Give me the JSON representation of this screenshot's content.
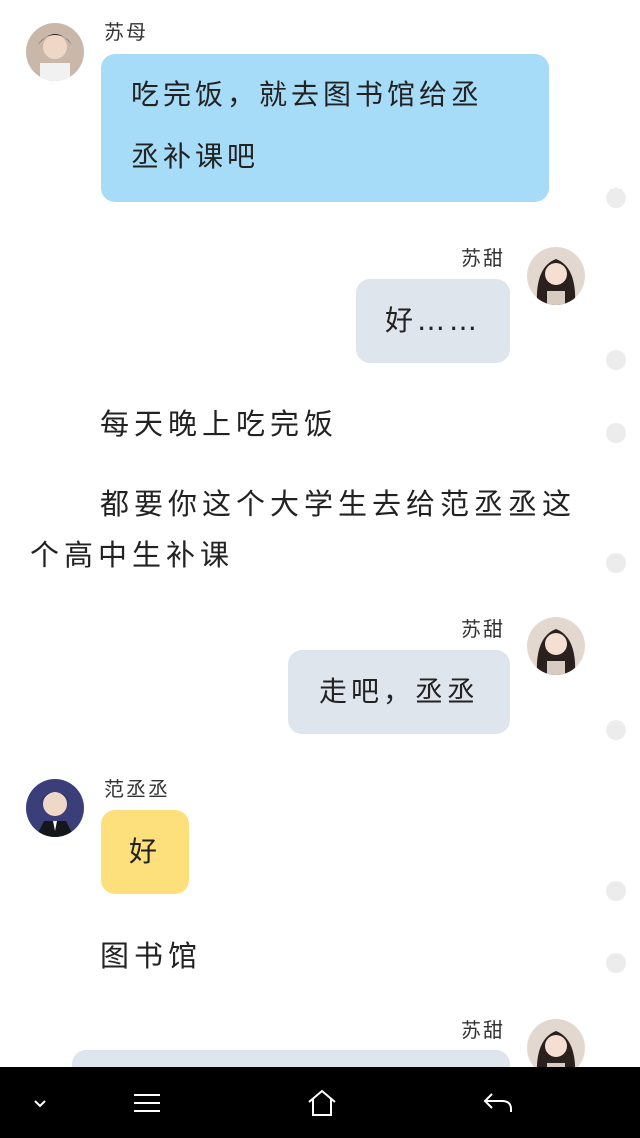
{
  "messages": [
    {
      "sender": "苏母",
      "lines": [
        "吃完饭，就去图书馆给丞",
        "丞补课吧"
      ]
    },
    {
      "sender": "苏甜",
      "text": "好……"
    },
    {
      "sender": "苏甜",
      "text": "走吧，丞丞"
    },
    {
      "sender": "范丞丞",
      "text": "好"
    },
    {
      "sender": "苏甜",
      "text": ""
    }
  ],
  "narration": [
    "每天晚上吃完饭",
    "都要你这个大学生去给范丞丞这",
    "个高中生补课",
    "图书馆"
  ],
  "colors": {
    "blue_bubble": "#a6dcf8",
    "gray_bubble": "#dfe5ed",
    "yellow_bubble": "#fde07c",
    "nav_bg": "#000000"
  },
  "nav": {
    "icons": [
      "chevron-down-icon",
      "menu-icon",
      "home-icon",
      "back-icon"
    ]
  }
}
